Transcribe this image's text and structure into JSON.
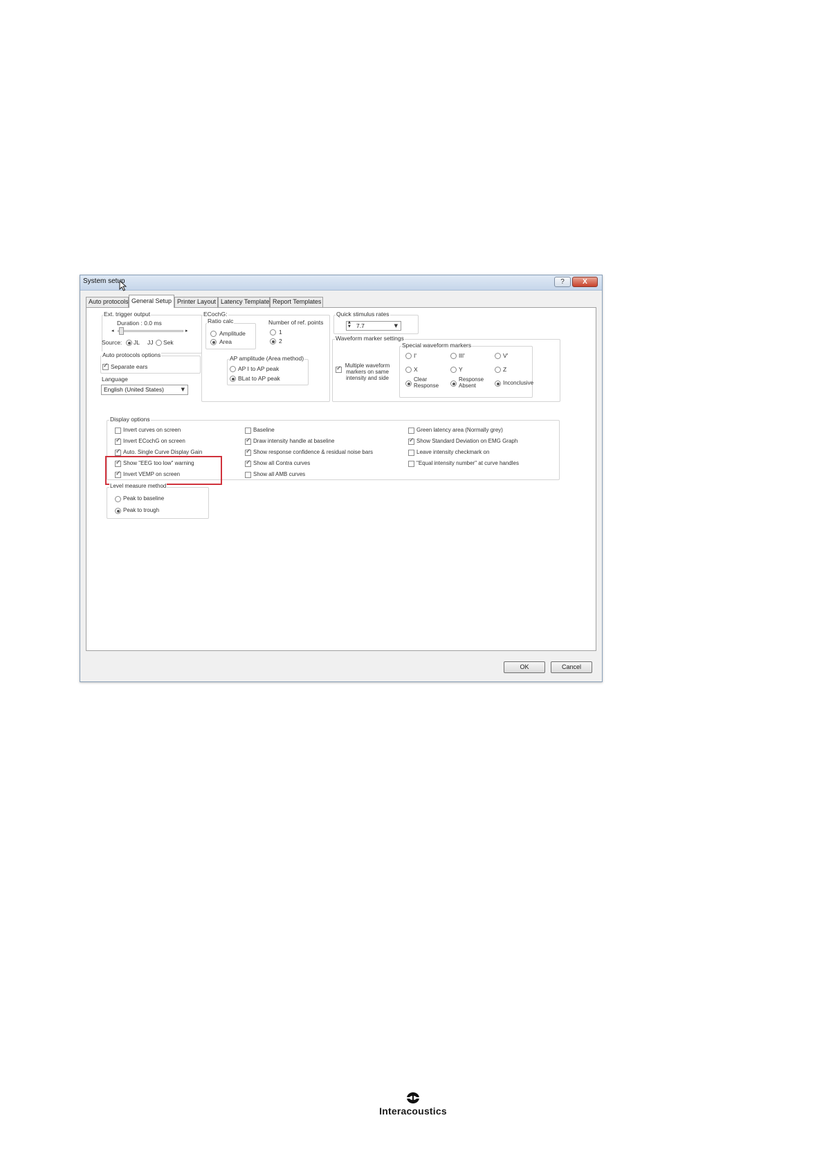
{
  "dialog": {
    "title": "System setup",
    "help_label": "?",
    "close_label": "X",
    "tabs": [
      "Auto protocols",
      "General Setup",
      "Printer Layout",
      "Latency Template",
      "Report Templates"
    ],
    "ext_trigger": {
      "title": "Ext. trigger output",
      "duration": "Duration :  0.0 ms",
      "source_label": "Source:",
      "source_options": [
        "JL",
        "JJ",
        "Sek"
      ]
    },
    "auto_protocols": {
      "title": "Auto protocols options",
      "separate_ears": "Separate ears"
    },
    "language": {
      "title": "Language",
      "value": "English (United States)"
    },
    "ecochg": {
      "title": "ECochG:",
      "ratio_title": "Ratio calc",
      "ratio_options": [
        "Amplitude",
        "Area"
      ],
      "ref_title": "Number of ref. points",
      "ref_options": [
        "1",
        "2"
      ],
      "ap_title": "AP amplitude (Area method)",
      "ap_options": [
        "AP I to AP peak",
        "BLat to AP peak"
      ]
    },
    "quick_stim": {
      "title": "Quick stimulus rates",
      "value": "7.7"
    },
    "waveform": {
      "title": "Waveform marker settings",
      "multiple": "Multiple waveform markers on same intensity and side",
      "special_title": "Special waveform markers",
      "markers": [
        "I'",
        "III'",
        "V'",
        "X",
        "Y",
        "Z",
        "Clear Response",
        "Response Absent",
        "Inconclusive"
      ]
    },
    "display": {
      "title": "Display options",
      "col1": [
        "Invert curves on screen",
        "Invert ECochG on screen",
        "Auto. Single Curve Display Gain",
        "Show \"EEG too low\" warning",
        "Invert VEMP on screen"
      ],
      "col2": [
        "Baseline",
        "Draw intensity handle at baseline",
        "Show response confidence & residual noise bars",
        "Show all Contra curves",
        "Show all AMB curves"
      ],
      "col3": [
        "Green latency area (Normally grey)",
        "Show Standard Deviation on EMG Graph",
        "Leave intensity checkmark on",
        "\"Equal intensity number\" at curve handles"
      ]
    },
    "level": {
      "title": "Level measure method",
      "options": [
        "Peak to baseline",
        "Peak to trough"
      ]
    },
    "ok_label": "OK",
    "cancel_label": "Cancel"
  },
  "footer": {
    "brand": "Interacoustics"
  }
}
